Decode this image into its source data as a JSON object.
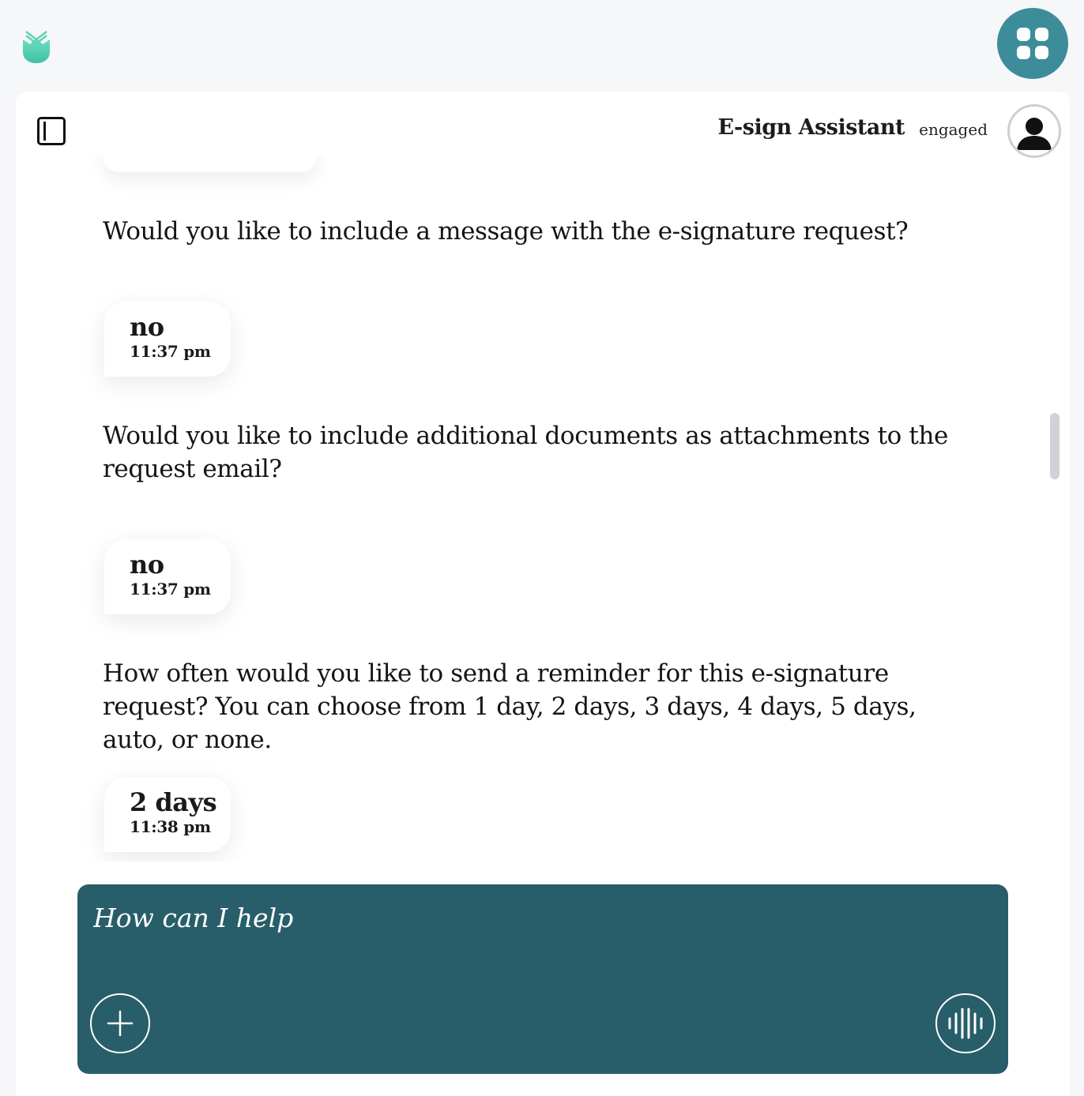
{
  "header": {
    "logo_icon": "tulip-logo-icon",
    "apps_icon": "grid-apps-icon"
  },
  "chat_header": {
    "assistant_name": "E-sign Assistant",
    "status": "engaged",
    "sidebar_icon": "sidebar-toggle-icon",
    "avatar_icon": "user-avatar-icon"
  },
  "messages": [
    {
      "role": "bot",
      "text": "Would you like to include a message with the e-signature request?"
    },
    {
      "role": "user",
      "text": "no",
      "time": "11:37 pm"
    },
    {
      "role": "bot",
      "text": "Would you like to include additional documents as attachments to the request email?"
    },
    {
      "role": "user",
      "text": "no",
      "time": "11:37 pm"
    },
    {
      "role": "bot",
      "text": "How often would you like to send a reminder for this e-signature request? You can choose from 1 day, 2 days, 3 days, 4 days, 5 days, auto, or none."
    },
    {
      "role": "user",
      "text": "2 days",
      "time": "11:38 pm"
    }
  ],
  "composer": {
    "placeholder": "How can I help",
    "add_icon": "plus-icon",
    "voice_icon": "voice-waveform-icon"
  },
  "colors": {
    "accent": "#3c8d99",
    "composer_bg": "#275e69",
    "logo": "#5fd3b4"
  }
}
